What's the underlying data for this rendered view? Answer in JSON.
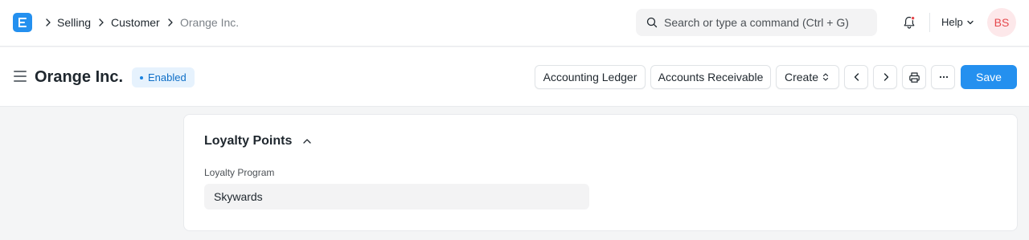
{
  "navbar": {
    "breadcrumbs": [
      "Selling",
      "Customer",
      "Orange Inc."
    ],
    "search_placeholder": "Search or type a command (Ctrl + G)",
    "help_label": "Help",
    "avatar_initials": "BS"
  },
  "page": {
    "title": "Orange Inc.",
    "status_badge": "Enabled",
    "actions": {
      "accounting_ledger": "Accounting Ledger",
      "accounts_receivable": "Accounts Receivable",
      "create": "Create",
      "save": "Save"
    }
  },
  "section": {
    "title": "Loyalty Points",
    "fields": [
      {
        "label": "Loyalty Program",
        "value": "Skywards"
      }
    ]
  },
  "colors": {
    "primary": "#2490ef",
    "badge_bg": "#e6f2fd",
    "badge_text": "#0f6fc7",
    "avatar_bg": "#fde8ea",
    "avatar_text": "#e5484d",
    "page_bg": "#f4f5f6"
  },
  "icons": [
    "app-logo-icon",
    "chevron-right-icon",
    "search-icon",
    "bell-icon",
    "chevron-down-icon",
    "hamburger-icon",
    "sort-icon",
    "chevron-left-icon",
    "printer-icon",
    "more-icon",
    "chevron-up-icon"
  ]
}
